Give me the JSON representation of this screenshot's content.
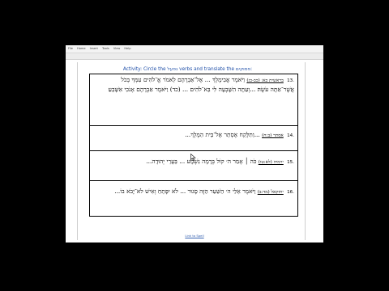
{
  "menu": [
    "File",
    "Home",
    "Insert",
    "Tools",
    "View",
    "Help"
  ],
  "activity": {
    "prefix": "Activity: Circle the",
    "middle": "נפעל",
    "rest": "verbs and translate the",
    "suffix": "פסוקים:"
  },
  "rows": [
    {
      "num": "13.",
      "ref": "בראשית כא: (כב-כג)",
      "text": "וַיֹּאמֶר אֲבִימֶלֶךְ ... אֶל־אַבְרָהָם לֵאמֹר אֱ־לֹהִים עִמְּךָ בְּכֹל אֲשֶׁר־אַתָּה עֹשֶׂה׃ ...וְעַתָּה הִשָּׁבְעָה לִּי בֵּא־לֹהִים ... (כד) וַיֹּאמֶר אַבְרָהָם אָנֹכִי אִשָּׁבֵעַ׃"
    },
    {
      "num": "14.",
      "ref": "אסתר (ב:ח)",
      "text": "...וַתִּלָּקַח אֶסְתֵּר אֶל־בֵּית הַמֶּלֶךְ..."
    },
    {
      "num": "15.",
      "ref": "ירמיה (לא:טו)",
      "text": "כֹּה ׀ אָמַר ה׳ קוֹל בְּרָמָה נִשְׁמָע ... בֵּעָרֵי יְהוּדָה..."
    },
    {
      "num": "16.",
      "ref": "יחזקאל (מד:ב)",
      "text": "וַיֹּאמֶר אֵלַי ה׳ הַשַּׁעַר הַזֶּה סָגוּר ... לֹא יִפָּתֵחַ וְאִישׁ לֹא־יָבֹא בוֹ..."
    }
  ],
  "footer": "Link to Spell"
}
